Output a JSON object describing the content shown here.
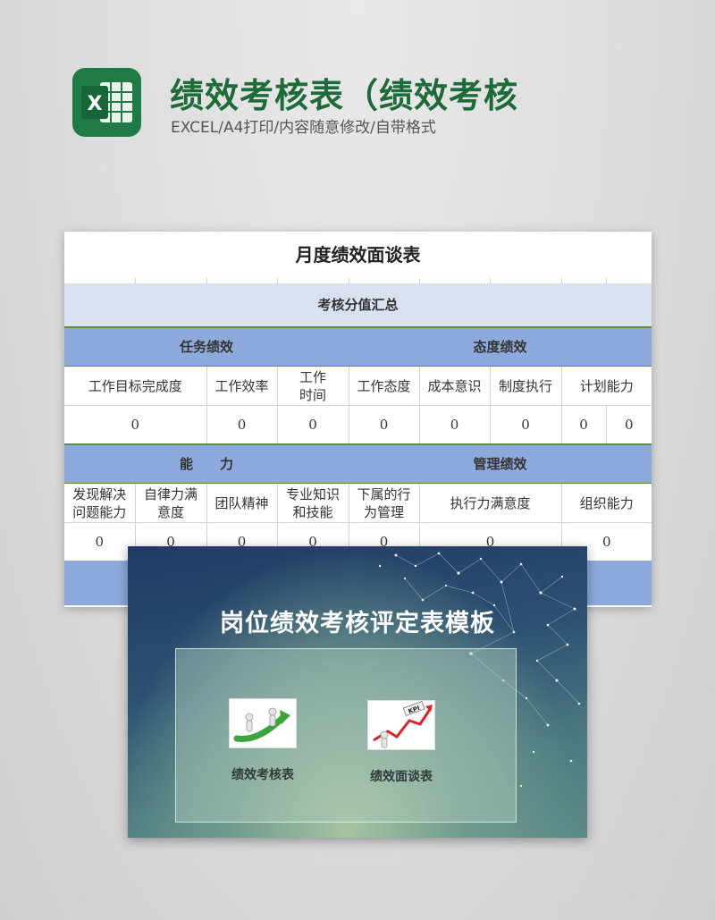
{
  "header": {
    "title": "绩效考核表（绩效考核",
    "subtitle": "EXCEL/A4打印/内容随意修改/自带格式",
    "app_icon": "excel-icon",
    "brand_color": "#1e6b3a"
  },
  "sheet": {
    "title": "月度绩效面谈表",
    "summary_label": "考核分值汇总",
    "group_task": "任务绩效",
    "group_attitude": "态度绩效",
    "task_items": [
      "工作目标完成度",
      "工作效率",
      "工作\n时间"
    ],
    "attitude_items": [
      "工作态度",
      "成本意识",
      "制度执行",
      "计划能力"
    ],
    "row1_values": [
      "0",
      "0",
      "0",
      "0",
      "0",
      "0",
      "0",
      "0"
    ],
    "group_ability": "能　　力",
    "group_management": "管理绩效",
    "ability_items": [
      "发现解决\n问题能力",
      "自律力满\n意度",
      "团队精神",
      "专业知识\n和技能"
    ],
    "management_items": [
      "下属的行\n为管理",
      "执行力满意度",
      "组织能力"
    ],
    "row2_values": [
      "0",
      "0",
      "0",
      "0",
      "0",
      "0",
      "0"
    ],
    "header_fill": "#8eaadc",
    "summary_fill": "#d9e1f1"
  },
  "slide": {
    "title": "岗位绩效考核评定表模板",
    "cards": [
      {
        "label": "绩效考核表",
        "icon": "growth-arrow-figures-icon"
      },
      {
        "label": "绩效面谈表",
        "icon": "kpi-chart-icon"
      }
    ]
  }
}
